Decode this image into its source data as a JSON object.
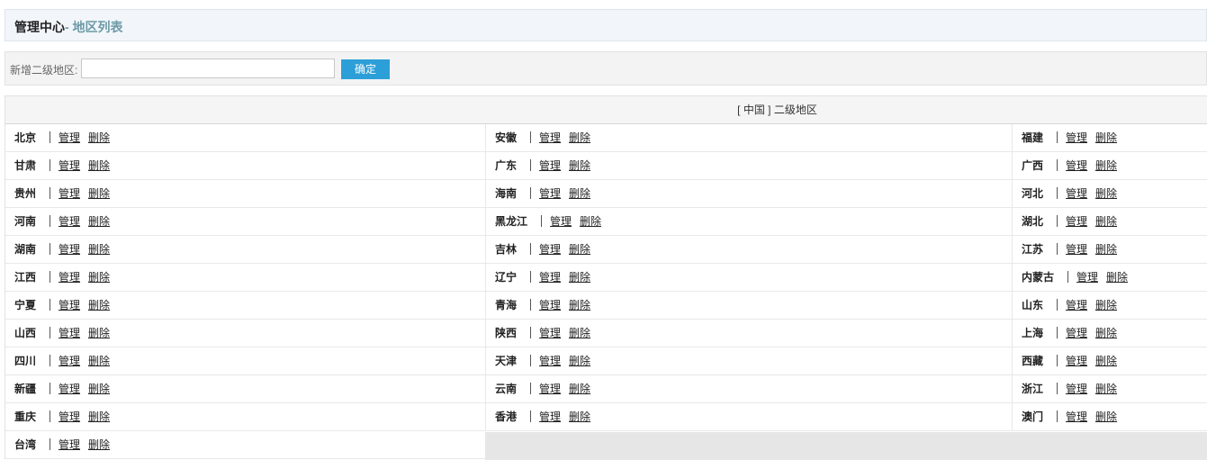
{
  "header": {
    "title": "管理中心",
    "subtitle": "- 地区列表"
  },
  "add_form": {
    "label": "新增二级地区:",
    "input_value": "",
    "confirm_label": "确定"
  },
  "table": {
    "heading": "[ 中国 ] 二级地区",
    "manage_label": "管理",
    "delete_label": "删除",
    "rows": [
      [
        "北京",
        "安徽",
        "福建"
      ],
      [
        "甘肃",
        "广东",
        "广西"
      ],
      [
        "贵州",
        "海南",
        "河北"
      ],
      [
        "河南",
        "黑龙江",
        "湖北"
      ],
      [
        "湖南",
        "吉林",
        "江苏"
      ],
      [
        "江西",
        "辽宁",
        "内蒙古"
      ],
      [
        "宁夏",
        "青海",
        "山东"
      ],
      [
        "山西",
        "陕西",
        "上海"
      ],
      [
        "四川",
        "天津",
        "西藏"
      ],
      [
        "新疆",
        "云南",
        "浙江"
      ],
      [
        "重庆",
        "香港",
        "澳门"
      ],
      [
        "台湾"
      ]
    ]
  }
}
